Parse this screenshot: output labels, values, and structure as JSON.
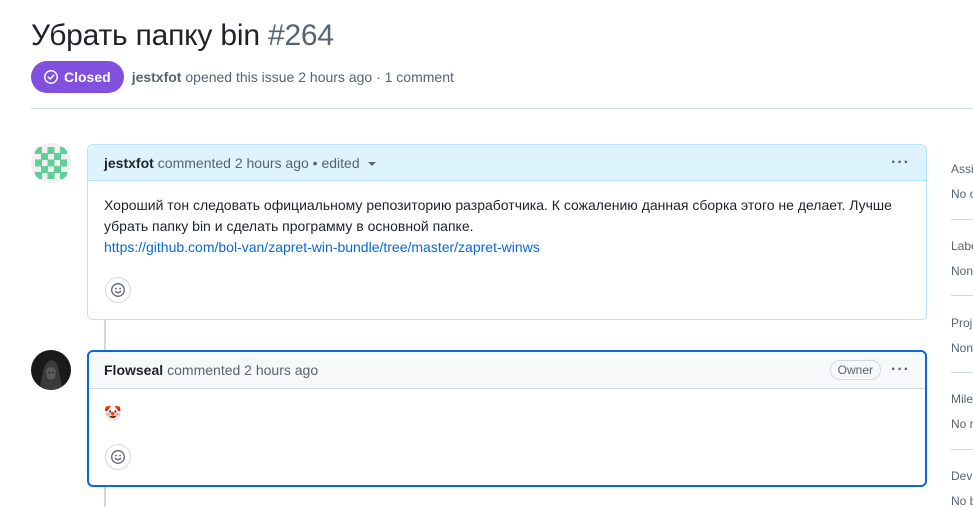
{
  "issue": {
    "title": "Убрать папку bin",
    "number": "#264",
    "state": "Closed",
    "author": "jestxfot",
    "opened_text": "opened this issue 2 hours ago · 1 comment"
  },
  "comments": [
    {
      "author": "jestxfot",
      "meta": "commented 2 hours ago • edited",
      "body": "Хороший тон следовать официальному репозиторию разработчика. К сожалению данная сборка этого не делает. Лучше убрать папку bin и сделать программу в основной папке.",
      "link": "https://github.com/bol-van/zapret-win-bundle/tree/master/zapret-winws",
      "menu": "···"
    },
    {
      "author": "Flowseal",
      "meta": "commented 2 hours ago",
      "badge": "Owner",
      "body": "🤡",
      "menu": "···"
    }
  ],
  "sidebar": [
    {
      "heading": "Assi",
      "value": "No o"
    },
    {
      "heading": "Labe",
      "value": "Non"
    },
    {
      "heading": "Proj",
      "value": "Non"
    },
    {
      "heading": "Mile",
      "value": "No r"
    },
    {
      "heading": "Dev",
      "value": "No b"
    }
  ],
  "colors": {
    "closed_badge": "#8250df",
    "link": "#0969da",
    "author_comment_header": "#ddf4ff",
    "selected_comment_border": "#0969da"
  },
  "icons": [
    "issue-closed-icon",
    "triangle-down-icon",
    "kebab-horizontal-icon",
    "smiley-icon",
    "avatar-identicon",
    "avatar-photo"
  ]
}
